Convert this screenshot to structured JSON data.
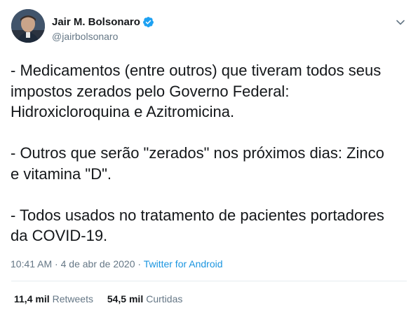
{
  "tweet": {
    "author": {
      "display_name": "Jair M. Bolsonaro",
      "handle": "@jairbolsonaro",
      "verified_icon": "verified-badge-icon"
    },
    "text": "- Medicamentos (entre outros) que tiveram todos seus\nimpostos zerados pelo Governo Federal:\nHidroxicloroquina e Azitromicina.\n\n- Outros que serão \"zerados\" nos próximos dias: Zinco\ne vitamina \"D\".\n\n- Todos usados no tratamento de pacientes portadores\nda COVID-19.",
    "time": "10:41 AM",
    "separator": "·",
    "date": "4 de abr de 2020",
    "source": "Twitter for Android",
    "stats": {
      "retweets_count": "11,4 mil",
      "retweets_label": "Retweets",
      "likes_count": "54,5 mil",
      "likes_label": "Curtidas"
    }
  },
  "colors": {
    "link": "#1b95e0",
    "secondary_text": "#657786",
    "verified": "#1da1f2"
  }
}
